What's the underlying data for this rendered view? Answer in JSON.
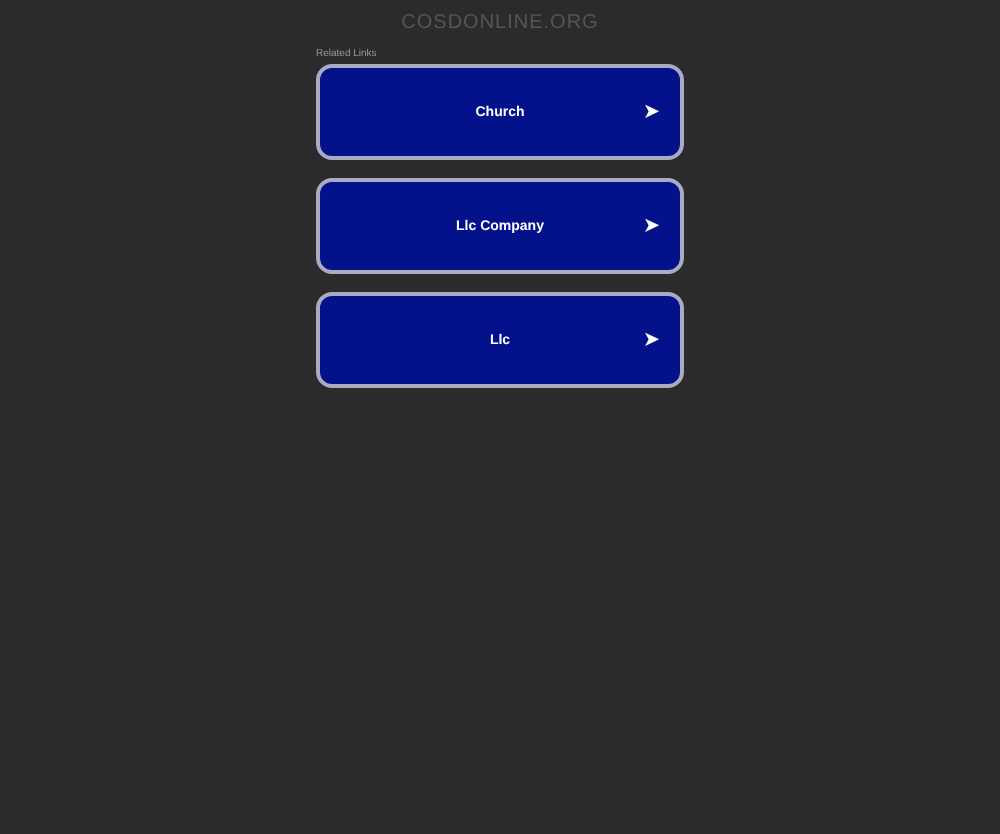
{
  "header": {
    "domain": "COSDONLINE.ORG"
  },
  "links_heading": "Related Links",
  "links": [
    {
      "label": "Church",
      "arrow": "➤"
    },
    {
      "label": "Llc Company",
      "arrow": "➤"
    },
    {
      "label": "Llc",
      "arrow": "➤"
    }
  ]
}
